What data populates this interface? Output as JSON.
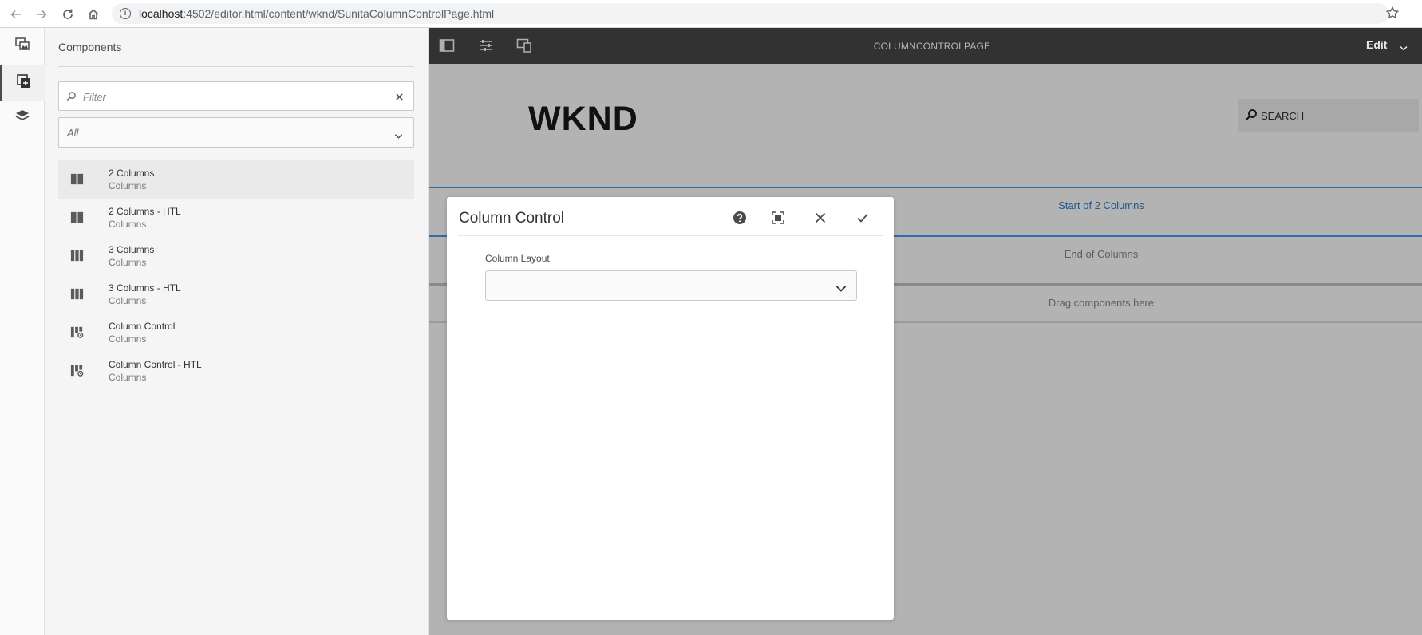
{
  "browser": {
    "url_host": "localhost",
    "url_path": ":4502/editor.html/content/wknd/SunitaColumnControlPage.html"
  },
  "panel": {
    "title": "Components",
    "filter_placeholder": "Filter",
    "group_filter": "All",
    "components": [
      {
        "name": "2 Columns",
        "group": "Columns",
        "icon": "two-columns-icon"
      },
      {
        "name": "2 Columns - HTL",
        "group": "Columns",
        "icon": "two-columns-icon"
      },
      {
        "name": "3 Columns",
        "group": "Columns",
        "icon": "three-columns-icon"
      },
      {
        "name": "3 Columns - HTL",
        "group": "Columns",
        "icon": "three-columns-icon"
      },
      {
        "name": "Column Control",
        "group": "Columns",
        "icon": "column-control-icon"
      },
      {
        "name": "Column Control - HTL",
        "group": "Columns",
        "icon": "column-control-icon"
      }
    ]
  },
  "toolbar": {
    "page_title": "COLUMNCONTROLPAGE",
    "mode_label": "Edit"
  },
  "page": {
    "logo": "WKND",
    "search_placeholder": "SEARCH",
    "start_label": "Start of 2 Columns",
    "end_label": "End of Columns",
    "drag_label": "Drag components here"
  },
  "dialog": {
    "title": "Column Control",
    "field_label": "Column Layout",
    "field_value": ""
  },
  "colors": {
    "toolbar_bg": "#323232",
    "editor_bg": "#b3b3b3",
    "accent": "#2d6ea8"
  }
}
